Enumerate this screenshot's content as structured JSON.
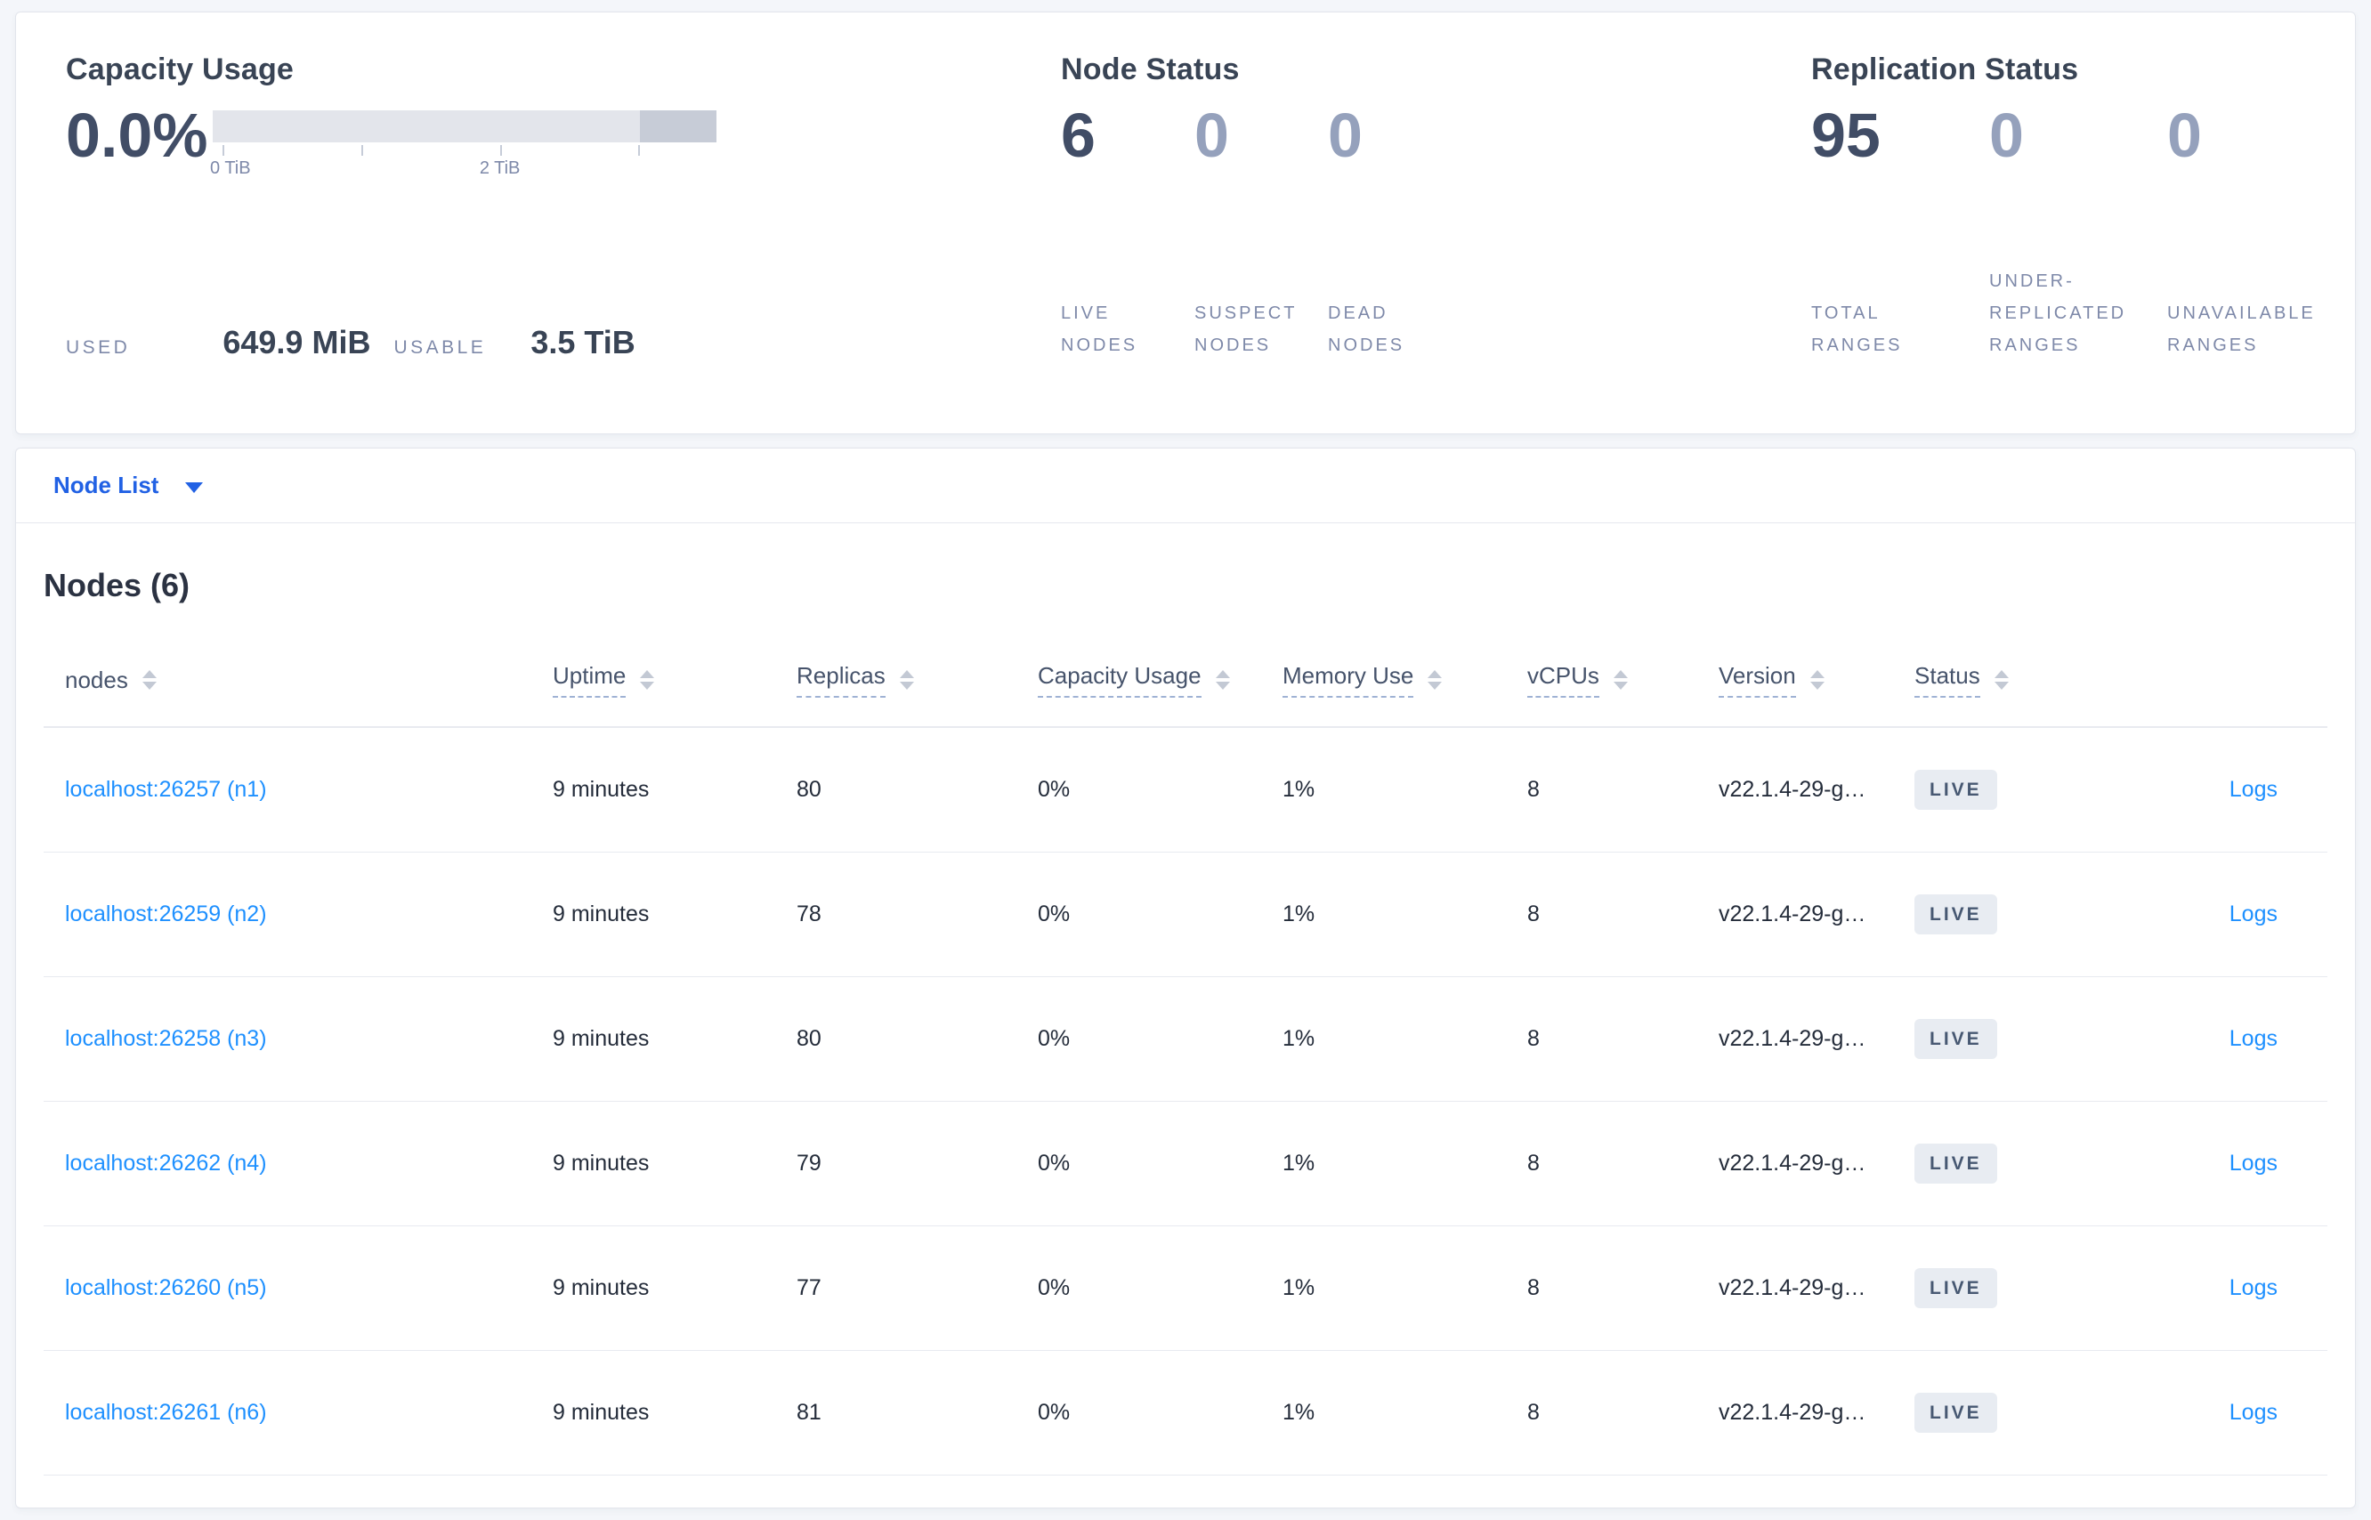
{
  "summary": {
    "capacity": {
      "title": "Capacity Usage",
      "percent": "0.0%",
      "axis_ticks": [
        "0 TiB",
        "2 TiB"
      ],
      "used_label": "USED",
      "used_value": "649.9 MiB",
      "usable_label": "USABLE",
      "usable_value": "3.5 TiB"
    },
    "node_status": {
      "title": "Node Status",
      "stats": [
        {
          "value": "6",
          "label": "LIVE\nNODES",
          "emphasis": true
        },
        {
          "value": "0",
          "label": "SUSPECT\nNODES",
          "emphasis": false
        },
        {
          "value": "0",
          "label": "DEAD\nNODES",
          "emphasis": false
        }
      ]
    },
    "replication": {
      "title": "Replication Status",
      "stats": [
        {
          "value": "95",
          "label": "TOTAL\nRANGES",
          "emphasis": true
        },
        {
          "value": "0",
          "label": "UNDER-\nREPLICATED\nRANGES",
          "emphasis": false
        },
        {
          "value": "0",
          "label": "UNAVAILABLE\nRANGES",
          "emphasis": false
        }
      ]
    }
  },
  "view_selector": {
    "label": "Node List"
  },
  "table": {
    "title": "Nodes (6)",
    "columns": [
      {
        "key": "address",
        "label": "nodes",
        "dashed": false
      },
      {
        "key": "uptime",
        "label": "Uptime",
        "dashed": true
      },
      {
        "key": "replicas",
        "label": "Replicas",
        "dashed": true
      },
      {
        "key": "capacity",
        "label": "Capacity Usage",
        "dashed": true
      },
      {
        "key": "memory",
        "label": "Memory Use",
        "dashed": true
      },
      {
        "key": "vcpus",
        "label": "vCPUs",
        "dashed": true
      },
      {
        "key": "version",
        "label": "Version",
        "dashed": true
      },
      {
        "key": "status",
        "label": "Status",
        "dashed": true
      },
      {
        "key": "logs",
        "label": "",
        "dashed": false
      }
    ],
    "rows": [
      {
        "address": "localhost:26257 (n1)",
        "uptime": "9 minutes",
        "replicas": "80",
        "capacity": "0%",
        "memory": "1%",
        "vcpus": "8",
        "version": "v22.1.4-29-g…",
        "status": "LIVE",
        "logs": "Logs"
      },
      {
        "address": "localhost:26259 (n2)",
        "uptime": "9 minutes",
        "replicas": "78",
        "capacity": "0%",
        "memory": "1%",
        "vcpus": "8",
        "version": "v22.1.4-29-g…",
        "status": "LIVE",
        "logs": "Logs"
      },
      {
        "address": "localhost:26258 (n3)",
        "uptime": "9 minutes",
        "replicas": "80",
        "capacity": "0%",
        "memory": "1%",
        "vcpus": "8",
        "version": "v22.1.4-29-g…",
        "status": "LIVE",
        "logs": "Logs"
      },
      {
        "address": "localhost:26262 (n4)",
        "uptime": "9 minutes",
        "replicas": "79",
        "capacity": "0%",
        "memory": "1%",
        "vcpus": "8",
        "version": "v22.1.4-29-g…",
        "status": "LIVE",
        "logs": "Logs"
      },
      {
        "address": "localhost:26260 (n5)",
        "uptime": "9 minutes",
        "replicas": "77",
        "capacity": "0%",
        "memory": "1%",
        "vcpus": "8",
        "version": "v22.1.4-29-g…",
        "status": "LIVE",
        "logs": "Logs"
      },
      {
        "address": "localhost:26261 (n6)",
        "uptime": "9 minutes",
        "replicas": "81",
        "capacity": "0%",
        "memory": "1%",
        "vcpus": "8",
        "version": "v22.1.4-29-g…",
        "status": "LIVE",
        "logs": "Logs"
      }
    ]
  },
  "colors": {
    "accent_blue": "#2161e4",
    "link_blue": "#1e90ff",
    "badge_bg": "#e8ecf2",
    "badge_text": "#475872",
    "bar_light": "#e3e5eb",
    "bar_dark": "#c7ccd7"
  }
}
